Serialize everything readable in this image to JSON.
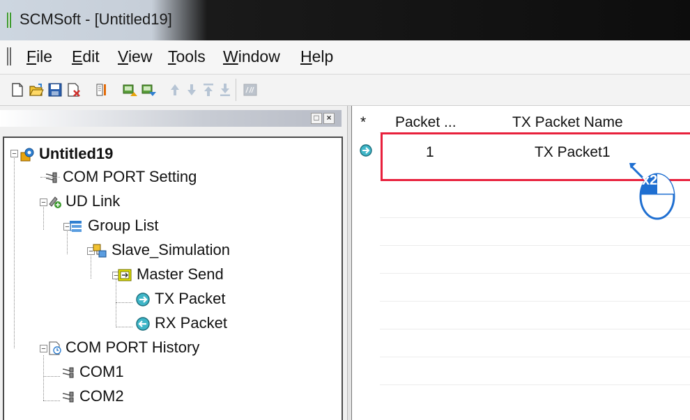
{
  "window": {
    "title": "SCMSoft - [Untitled19]"
  },
  "menu": [
    {
      "accel": "F",
      "rest": "ile"
    },
    {
      "accel": "E",
      "rest": "dit"
    },
    {
      "accel": "V",
      "rest": "iew"
    },
    {
      "accel": "T",
      "rest": "ools"
    },
    {
      "accel": "W",
      "rest": "indow"
    },
    {
      "accel": "H",
      "rest": "elp"
    }
  ],
  "toolbar": {
    "buttons": [
      "new-file-icon",
      "open-folder-icon",
      "save-icon",
      "close-file-icon",
      "tool-icon",
      "upload-icon",
      "download-icon",
      "move-up-icon",
      "move-down-icon",
      "move-top-icon",
      "move-bottom-icon",
      "script-icon"
    ]
  },
  "left_panel": {
    "header_buttons": [
      "□",
      "×"
    ]
  },
  "tree": [
    {
      "label": "Untitled19",
      "icon": "project-icon"
    },
    {
      "label": "COM PORT Setting",
      "icon": "com-port-icon"
    },
    {
      "label": "UD Link",
      "icon": "ud-link-icon"
    },
    {
      "label": "Group List",
      "icon": "group-list-icon"
    },
    {
      "label": "Slave_Simulation",
      "icon": "slave-icon"
    },
    {
      "label": "Master Send",
      "icon": "master-send-icon"
    },
    {
      "label": "TX Packet",
      "icon": "tx-packet-icon"
    },
    {
      "label": "RX Packet",
      "icon": "rx-packet-icon"
    },
    {
      "label": "COM PORT History",
      "icon": "history-icon"
    },
    {
      "label": "COM1",
      "icon": "com-port-icon"
    },
    {
      "label": "COM2",
      "icon": "com-port-icon"
    }
  ],
  "table": {
    "columns": [
      "*",
      "Packet ...",
      "TX Packet Name"
    ],
    "rows": [
      {
        "index": "1",
        "name": "TX Packet1",
        "icon": "tx-packet-icon"
      }
    ]
  },
  "annotation": {
    "double_click_label": "x2",
    "color": "#e8203c",
    "arrow_color": "#1f6fd1"
  }
}
